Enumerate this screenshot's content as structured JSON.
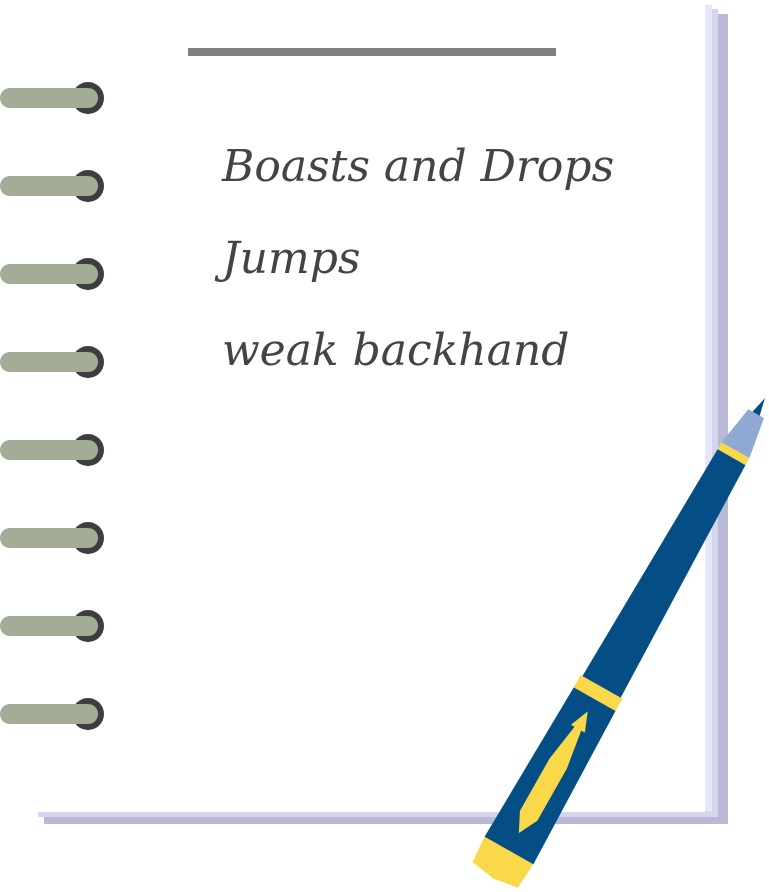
{
  "notebook": {
    "notes": [
      "Boasts and Drops",
      "Jumps",
      "weak backhand"
    ],
    "ring_count": 8
  },
  "colors": {
    "page": "#ffffff",
    "page_edge_light": "#e6e6fa",
    "page_edge_mid": "#d5d5ee",
    "page_edge_dark": "#b9b9d6",
    "top_bar": "#808080",
    "ink": "#444444",
    "ring_bar": "#a3ac97",
    "ring_hole": "#3d3d3d",
    "pen_body": "#044e85",
    "pen_accent": "#f9d84a",
    "pen_tip": "#8fa8d4"
  },
  "icons": {
    "rings": "spiral-ring-icon",
    "pen": "fountain-pen-icon"
  }
}
